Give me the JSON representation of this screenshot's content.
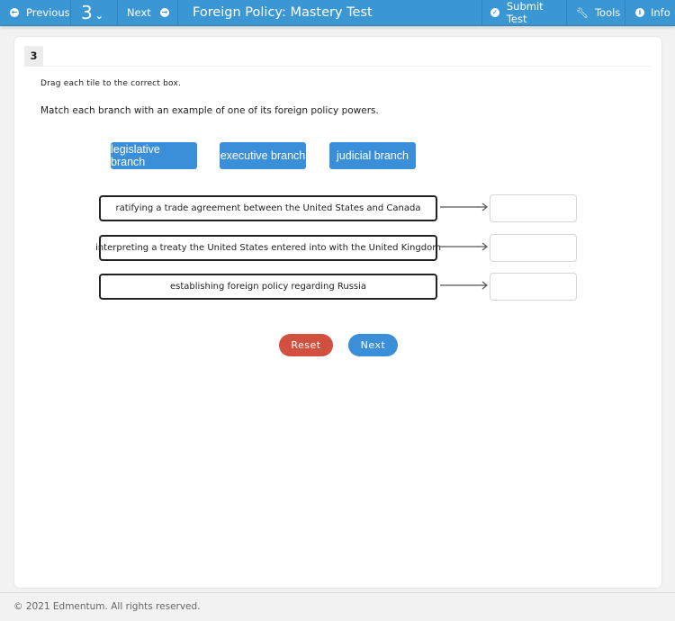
{
  "topbar": {
    "previous_label": "Previous",
    "question_number": "3",
    "next_label": "Next",
    "title": "Foreign Policy: Mastery Test",
    "submit_label": "Submit Test",
    "tools_label": "Tools",
    "info_label": "Info"
  },
  "question": {
    "number": "3",
    "instruction": "Drag each tile to the correct box.",
    "prompt": "Match each branch with an example of one of its foreign policy powers."
  },
  "tiles": [
    {
      "label": "legislative branch"
    },
    {
      "label": "executive branch"
    },
    {
      "label": "judicial branch"
    }
  ],
  "items": [
    {
      "text": "ratifying a trade agreement between the United States and Canada",
      "answer": ""
    },
    {
      "text": "interpreting a treaty the United States entered into with the United Kingdom",
      "answer": ""
    },
    {
      "text": "establishing foreign policy regarding Russia",
      "answer": ""
    }
  ],
  "buttons": {
    "reset_label": "Reset",
    "next_label": "Next"
  },
  "footer": {
    "copyright": "© 2021 Edmentum. All rights reserved."
  },
  "colors": {
    "topbar": "#3a97d4",
    "tile": "#3b8fd9",
    "reset": "#d2503f",
    "next": "#3b8fd9"
  }
}
